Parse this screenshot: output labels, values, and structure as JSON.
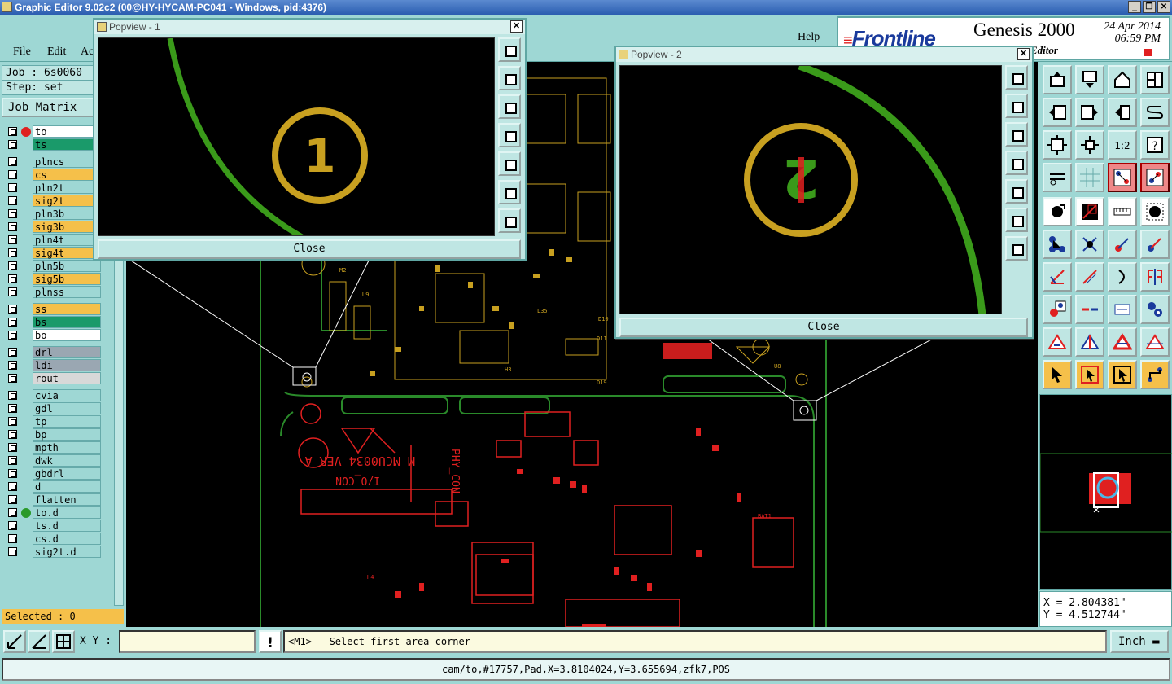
{
  "window": {
    "title": "Graphic Editor 9.02c2 (00@HY-HYCAM-PC041 - Windows, pid:4376)"
  },
  "menu": {
    "file": "File",
    "edit": "Edit",
    "action": "Ac",
    "help": "Help"
  },
  "brand": {
    "logo": "Frontline",
    "product": "Genesis 2000",
    "date": "24 Apr 2014",
    "time": "06:59 PM",
    "subtitle": "Editor"
  },
  "job": {
    "job_label": "Job : 6s0060",
    "step_label": "Step: set",
    "matrix_button": "Job Matrix"
  },
  "layers": [
    {
      "name": "to",
      "color": "#ffffff",
      "marker": "#e02020"
    },
    {
      "name": "ts",
      "color": "#1a9a6a",
      "marker": ""
    },
    {
      "name": "plncs",
      "color": "#9ed7d4",
      "marker": ""
    },
    {
      "name": "cs",
      "color": "#f5c04a",
      "marker": ""
    },
    {
      "name": "pln2t",
      "color": "#9ed7d4",
      "marker": ""
    },
    {
      "name": "sig2t",
      "color": "#f5c04a",
      "marker": ""
    },
    {
      "name": "pln3b",
      "color": "#9ed7d4",
      "marker": ""
    },
    {
      "name": "sig3b",
      "color": "#f5c04a",
      "marker": ""
    },
    {
      "name": "pln4t",
      "color": "#9ed7d4",
      "marker": ""
    },
    {
      "name": "sig4t",
      "color": "#f5c04a",
      "marker": ""
    },
    {
      "name": "pln5b",
      "color": "#9ed7d4",
      "marker": ""
    },
    {
      "name": "sig5b",
      "color": "#f5c04a",
      "marker": ""
    },
    {
      "name": "plnss",
      "color": "#9ed7d4",
      "marker": ""
    },
    {
      "name": "ss",
      "color": "#f5c04a",
      "marker": ""
    },
    {
      "name": "bs",
      "color": "#1a9a6a",
      "marker": ""
    },
    {
      "name": "bo",
      "color": "#ffffff",
      "marker": ""
    },
    {
      "name": "drl",
      "color": "#9aa7b2",
      "marker": ""
    },
    {
      "name": "ldi",
      "color": "#9aa7b2",
      "marker": ""
    },
    {
      "name": "rout",
      "color": "#d8d8d8",
      "marker": ""
    },
    {
      "name": "cvia",
      "color": "#9ed7d4",
      "marker": ""
    },
    {
      "name": "gdl",
      "color": "#9ed7d4",
      "marker": ""
    },
    {
      "name": "tp",
      "color": "#9ed7d4",
      "marker": ""
    },
    {
      "name": "bp",
      "color": "#9ed7d4",
      "marker": ""
    },
    {
      "name": "mpth",
      "color": "#9ed7d4",
      "marker": ""
    },
    {
      "name": "dwk",
      "color": "#9ed7d4",
      "marker": ""
    },
    {
      "name": "gbdrl",
      "color": "#9ed7d4",
      "marker": ""
    },
    {
      "name": "d",
      "color": "#9ed7d4",
      "marker": ""
    },
    {
      "name": "flatten",
      "color": "#9ed7d4",
      "marker": ""
    },
    {
      "name": "to.d",
      "color": "#9ed7d4",
      "marker": "#2a9a2a"
    },
    {
      "name": "ts.d",
      "color": "#9ed7d4",
      "marker": ""
    },
    {
      "name": "cs.d",
      "color": "#9ed7d4",
      "marker": ""
    },
    {
      "name": "sig2t.d",
      "color": "#9ed7d4",
      "marker": ""
    }
  ],
  "selected": "Selected : 0",
  "popview1": {
    "title": "Popview - 1",
    "marker": "1",
    "close": "Close"
  },
  "popview2": {
    "title": "Popview - 2",
    "marker": "2",
    "close": "Close"
  },
  "coords": {
    "x": "X = 2.804381\"",
    "y": "Y = 4.512744\""
  },
  "xy": {
    "label": "X Y :",
    "value": ""
  },
  "prompt": "<M1> - Select first area corner",
  "units": "Inch",
  "status": "cam/to,#17757,Pad,X=3.8104024,Y=3.655694,zfk7,POS",
  "board_labels": [
    "M MCU0034 VER_A",
    "I/O_CON",
    "PHY_CON",
    "BAT1",
    "M2",
    "H3",
    "H4",
    "U8",
    "U9",
    "D10",
    "D11",
    "D19",
    "L35"
  ]
}
